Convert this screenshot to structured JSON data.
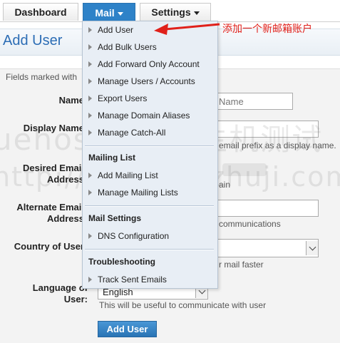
{
  "nav": {
    "tabs": [
      {
        "label": "Dashboard"
      },
      {
        "label": "Mail"
      },
      {
        "label": "Settings"
      }
    ]
  },
  "page": {
    "title": "Add User",
    "required_note": "Fields marked with"
  },
  "form": {
    "name_label": "Name",
    "name_placeholder": "Name",
    "display_name_label": "Display Name",
    "display_name_hint": "email prefix as a display name.",
    "desired_email_label_line1": "Desired Email",
    "desired_email_label_line2": "Address",
    "desired_email_hint": "ain",
    "alternate_email_label_line1": "Alternate Email",
    "alternate_email_label_line2": "Address",
    "alternate_email_hint": "communications",
    "country_label": "Country of User",
    "country_hint": "r mail faster",
    "language_label_line1": "Language of",
    "language_label_line2": "User:",
    "language_value": "English",
    "language_hint": "This will be useful to communicate with user",
    "submit_label": "Add User"
  },
  "mail_menu": {
    "items_main": [
      {
        "label": "Add User"
      },
      {
        "label": "Add Bulk Users"
      },
      {
        "label": "Add Forward Only Account"
      },
      {
        "label": "Manage Users / Accounts"
      },
      {
        "label": "Export Users"
      },
      {
        "label": "Manage Domain Aliases"
      },
      {
        "label": "Manage Catch-All"
      }
    ],
    "mailing_list_heading": "Mailing List",
    "mailing_list_items": [
      {
        "label": "Add Mailing List"
      },
      {
        "label": "Manage Mailing Lists"
      }
    ],
    "mail_settings_heading": "Mail Settings",
    "mail_settings_items": [
      {
        "label": "DNS Configuration"
      }
    ],
    "troubleshooting_heading": "Troubleshooting",
    "troubleshooting_items": [
      {
        "label": "Track Sent Emails"
      }
    ]
  },
  "annotation": {
    "text": "添加一个新邮箱账户",
    "color": "#e0201a"
  },
  "watermark": {
    "line1": "uehost海外云主机测试",
    "line2": "http://www.bluzhuji.com/"
  },
  "colors": {
    "accent": "#2e82c8",
    "title": "#2c6db5"
  }
}
